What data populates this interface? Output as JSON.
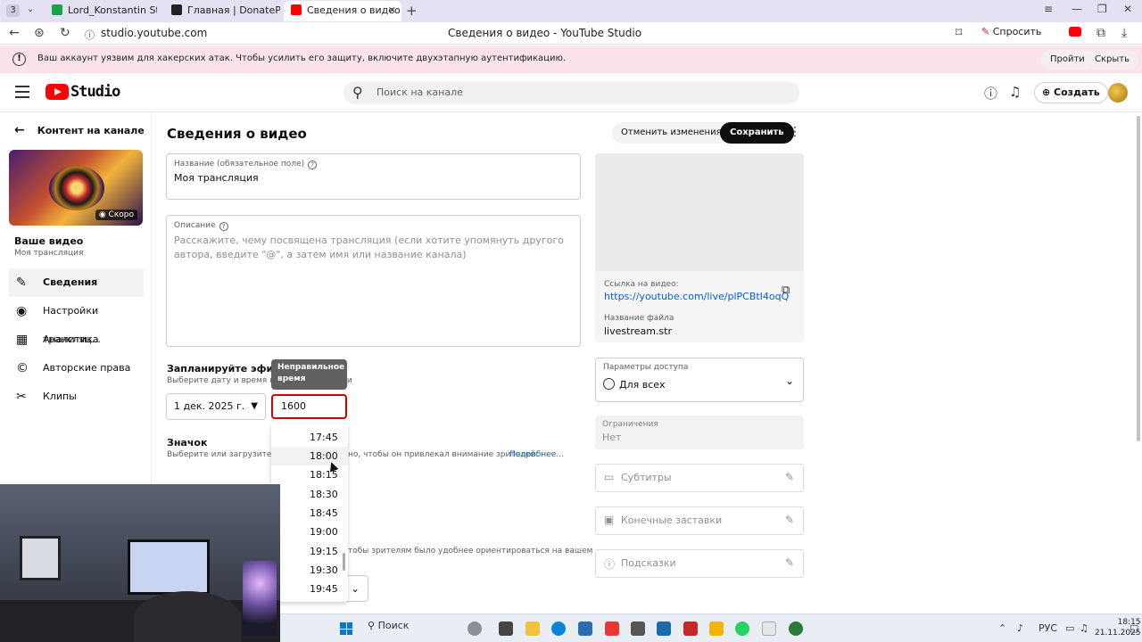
{
  "browser": {
    "tab_count": "3",
    "tabs": [
      {
        "title": "Lord_Konstantin Stream -"
      },
      {
        "title": "Главная | DonatePay"
      },
      {
        "title": "Сведения о видео - Yo"
      }
    ],
    "url": "studio.youtube.com",
    "window_title": "Сведения о видео - YouTube Studio",
    "ask_label": "Спросить"
  },
  "banner": {
    "text": "Ваш аккаунт уязвим для хакерских атак. Чтобы усилить его защиту, включите двухэтапную аутентификацию.",
    "go_label": "Пройти",
    "hide_label": "Скрыть"
  },
  "header": {
    "logo_text": "Studio",
    "search_placeholder": "Поиск на канале",
    "create_label": "Создать"
  },
  "sidebar": {
    "back_label": "Контент на канале",
    "thumb_badge": "Скоро",
    "your_video": "Ваше видео",
    "video_name": "Моя трансляция",
    "items": [
      {
        "label": "Сведения",
        "icon": "pencil-icon"
      },
      {
        "label": "Настройки трансляц...",
        "icon": "broadcast-icon"
      },
      {
        "label": "Аналитика",
        "icon": "analytics-icon"
      },
      {
        "label": "Авторские права",
        "icon": "copyright-icon"
      },
      {
        "label": "Клипы",
        "icon": "scissors-icon"
      }
    ]
  },
  "main": {
    "title": "Сведения о видео",
    "discard_label": "Отменить изменения",
    "save_label": "Сохранить",
    "title_field": {
      "label": "Название (обязательное поле)",
      "value": "Моя трансляция"
    },
    "description_field": {
      "label": "Описание",
      "placeholder": "Расскажите, чему посвящена трансляция (если хотите упомянуть другого автора, введите \"@\", а затем имя или название канала)"
    },
    "schedule": {
      "title": "Запланируйте эфир",
      "subtitle": "Выберите дату и время начала трансляции",
      "date": "1 дек. 2025 г.",
      "time_value": "1600",
      "tooltip": "Неправильное время",
      "time_options": [
        "17:45",
        "18:00",
        "18:15",
        "18:30",
        "18:45",
        "19:00",
        "19:15",
        "19:30",
        "19:45"
      ]
    },
    "thumbnail": {
      "title": "Значок",
      "subtitle_a": "Выберите или загрузите знач",
      "subtitle_b": "но, чтобы он привлекал внимание зрителей.",
      "more_link": "Подробнее..."
    },
    "playlist_sub": "тобы зрителям было удобнее ориентироваться на вашем"
  },
  "right": {
    "link_label": "Ссылка на видео:",
    "link": "https://youtube.com/live/plPCBtI4oqQ",
    "filename_label": "Название файла",
    "filename": "livestream.str",
    "visibility_label": "Параметры доступа",
    "visibility_value": "Для всех",
    "restrictions_label": "Ограничения",
    "restrictions_value": "Нет",
    "options": [
      {
        "label": "Субтитры",
        "icon": "subtitles-icon"
      },
      {
        "label": "Конечные заставки",
        "icon": "end-screen-icon"
      },
      {
        "label": "Подсказки",
        "icon": "info-icon"
      }
    ]
  },
  "taskbar": {
    "search_label": "Поиск",
    "language": "РУС",
    "time": "18:15",
    "date": "21.11.2025"
  }
}
